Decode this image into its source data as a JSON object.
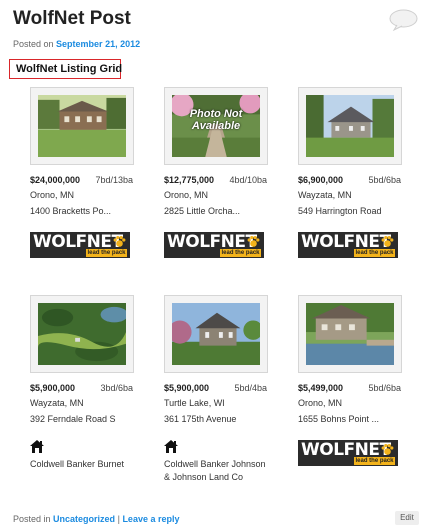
{
  "post": {
    "title": "WolfNet Post",
    "posted_on_label": "Posted on",
    "date": "September 21, 2012"
  },
  "widget": {
    "title": "WolfNet Listing Grid"
  },
  "logo": {
    "word": "WOLFNET",
    "tagline": "lead the pack"
  },
  "listings": [
    {
      "price": "$24,000,000",
      "beds_baths": "7bd/13ba",
      "city": "Orono, MN",
      "street": "1400 Bracketts Po...",
      "photo": "mansion-lawn"
    },
    {
      "price": "$12,775,000",
      "beds_baths": "4bd/10ba",
      "city": "Orono, MN",
      "street": "2825 Little Orcha...",
      "photo": "not-available",
      "photo_text": [
        "Photo Not",
        "Available"
      ]
    },
    {
      "price": "$6,900,000",
      "beds_baths": "5bd/6ba",
      "city": "Wayzata, MN",
      "street": "549 Harrington Road",
      "photo": "stone-house"
    },
    {
      "price": "$5,900,000",
      "beds_baths": "3bd/6ba",
      "city": "Wayzata, MN",
      "street": "392 Ferndale Road S",
      "photo": "aerial-lake"
    },
    {
      "price": "$5,900,000",
      "beds_baths": "5bd/4ba",
      "city": "Turtle Lake, WI",
      "street": "361 175th Avenue",
      "photo": "spring-house"
    },
    {
      "price": "$5,499,000",
      "beds_baths": "5bd/6ba",
      "city": "Orono, MN",
      "street": "1655 Bohns Point ...",
      "photo": "lake-house"
    }
  ],
  "brokerages": [
    {
      "lines": [
        "Coldwell Banker Burnet"
      ]
    },
    {
      "lines": [
        "Coldwell Banker Johnson",
        "& Johnson Land Co"
      ]
    }
  ],
  "footer": {
    "posted_in_label": "Posted in",
    "category": "Uncategorized",
    "separator": "|",
    "reply_link": "Leave a reply",
    "edit_label": "Edit"
  },
  "colors": {
    "link": "#1b8be0",
    "highlight_border": "#d9262a",
    "logo_bg": "#2b2b2b",
    "logo_accent": "#f3b31b"
  }
}
